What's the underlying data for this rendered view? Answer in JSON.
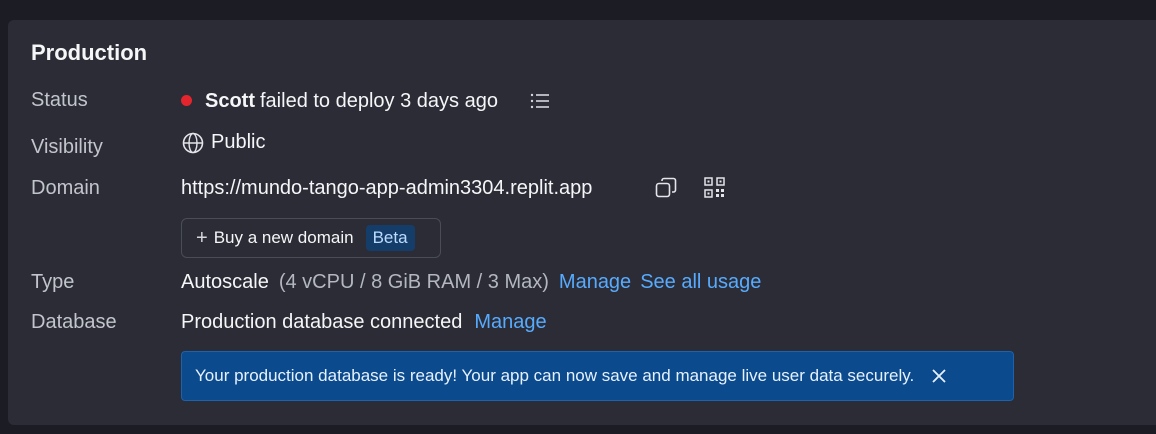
{
  "section": {
    "title": "Production"
  },
  "status": {
    "label": "Status",
    "user": "Scott",
    "message": "failed to deploy 3 days ago",
    "dot_color": "#e5252d",
    "log_icon": "list-icon"
  },
  "visibility": {
    "label": "Visibility",
    "icon": "globe-icon",
    "value": "Public"
  },
  "domain": {
    "label": "Domain",
    "url": "https://mundo-tango-app-admin3304.replit.app",
    "copy_icon": "copy-icon",
    "qr_icon": "qr-code-icon",
    "buy_button_label": "Buy a new domain",
    "buy_badge": "Beta"
  },
  "type": {
    "label": "Type",
    "value": "Autoscale",
    "spec": "(4 vCPU / 8 GiB RAM / 3 Max)",
    "manage_link": "Manage",
    "usage_link": "See all usage"
  },
  "database": {
    "label": "Database",
    "value": "Production database connected",
    "manage_link": "Manage"
  },
  "banner": {
    "message": "Your production database is ready! Your app can now save and manage live user data securely.",
    "close_icon": "close-icon"
  }
}
